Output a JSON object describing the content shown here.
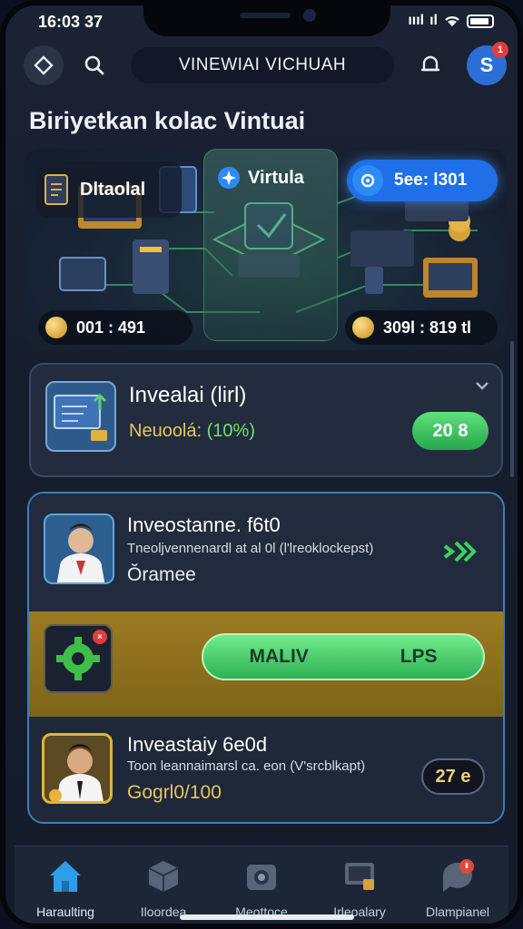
{
  "status_bar": {
    "time": "16:03 37",
    "signal_text": "ıııl",
    "network": "ıl"
  },
  "top_bar": {
    "title": "VINEWIAI VICHUAH",
    "avatar_badge": "1",
    "avatar_letter": "S"
  },
  "page_heading": "Biriyetkan kolac Vintuai",
  "hero": {
    "left_card_label": "Dltaolal",
    "center_label": "Virtula",
    "pill_label": "5ee: l301",
    "stat_left": "001 : 491",
    "stat_right": "309l : 819 tl"
  },
  "card1": {
    "title": "Invealai (lirl)",
    "subtitle_prefix": "Neuoolá:",
    "subtitle_pct": "(10%)",
    "button": "20 8"
  },
  "card2": {
    "title": "Inveostanne. f6t0",
    "subtitle": "Tneoljvennenardl at al 0l (l'lreoklockepst)",
    "note": "Ŏramee"
  },
  "gold_band": {
    "button_left": "MALIV",
    "button_right": "LPS"
  },
  "card3": {
    "title": "Inveastaiy 6e0d",
    "subtitle": "Toon leannaimarsl ca. eon (V'srcblkapt)",
    "note": "Gogrl0/100",
    "badge": "27 e"
  },
  "bottom_nav": [
    {
      "label": "Haraulting",
      "icon": "home-icon"
    },
    {
      "label": "Iloordea",
      "icon": "cube-icon"
    },
    {
      "label": "Meottoce",
      "icon": "camera-icon"
    },
    {
      "label": "Irleoalary",
      "icon": "monitor-icon"
    },
    {
      "label": "Dlampianel",
      "icon": "chat-alert-icon"
    }
  ],
  "colors": {
    "accent_green": "#3fc062",
    "accent_blue": "#1f6fe8",
    "gold": "#e6c65c",
    "background": "#161e2e"
  }
}
